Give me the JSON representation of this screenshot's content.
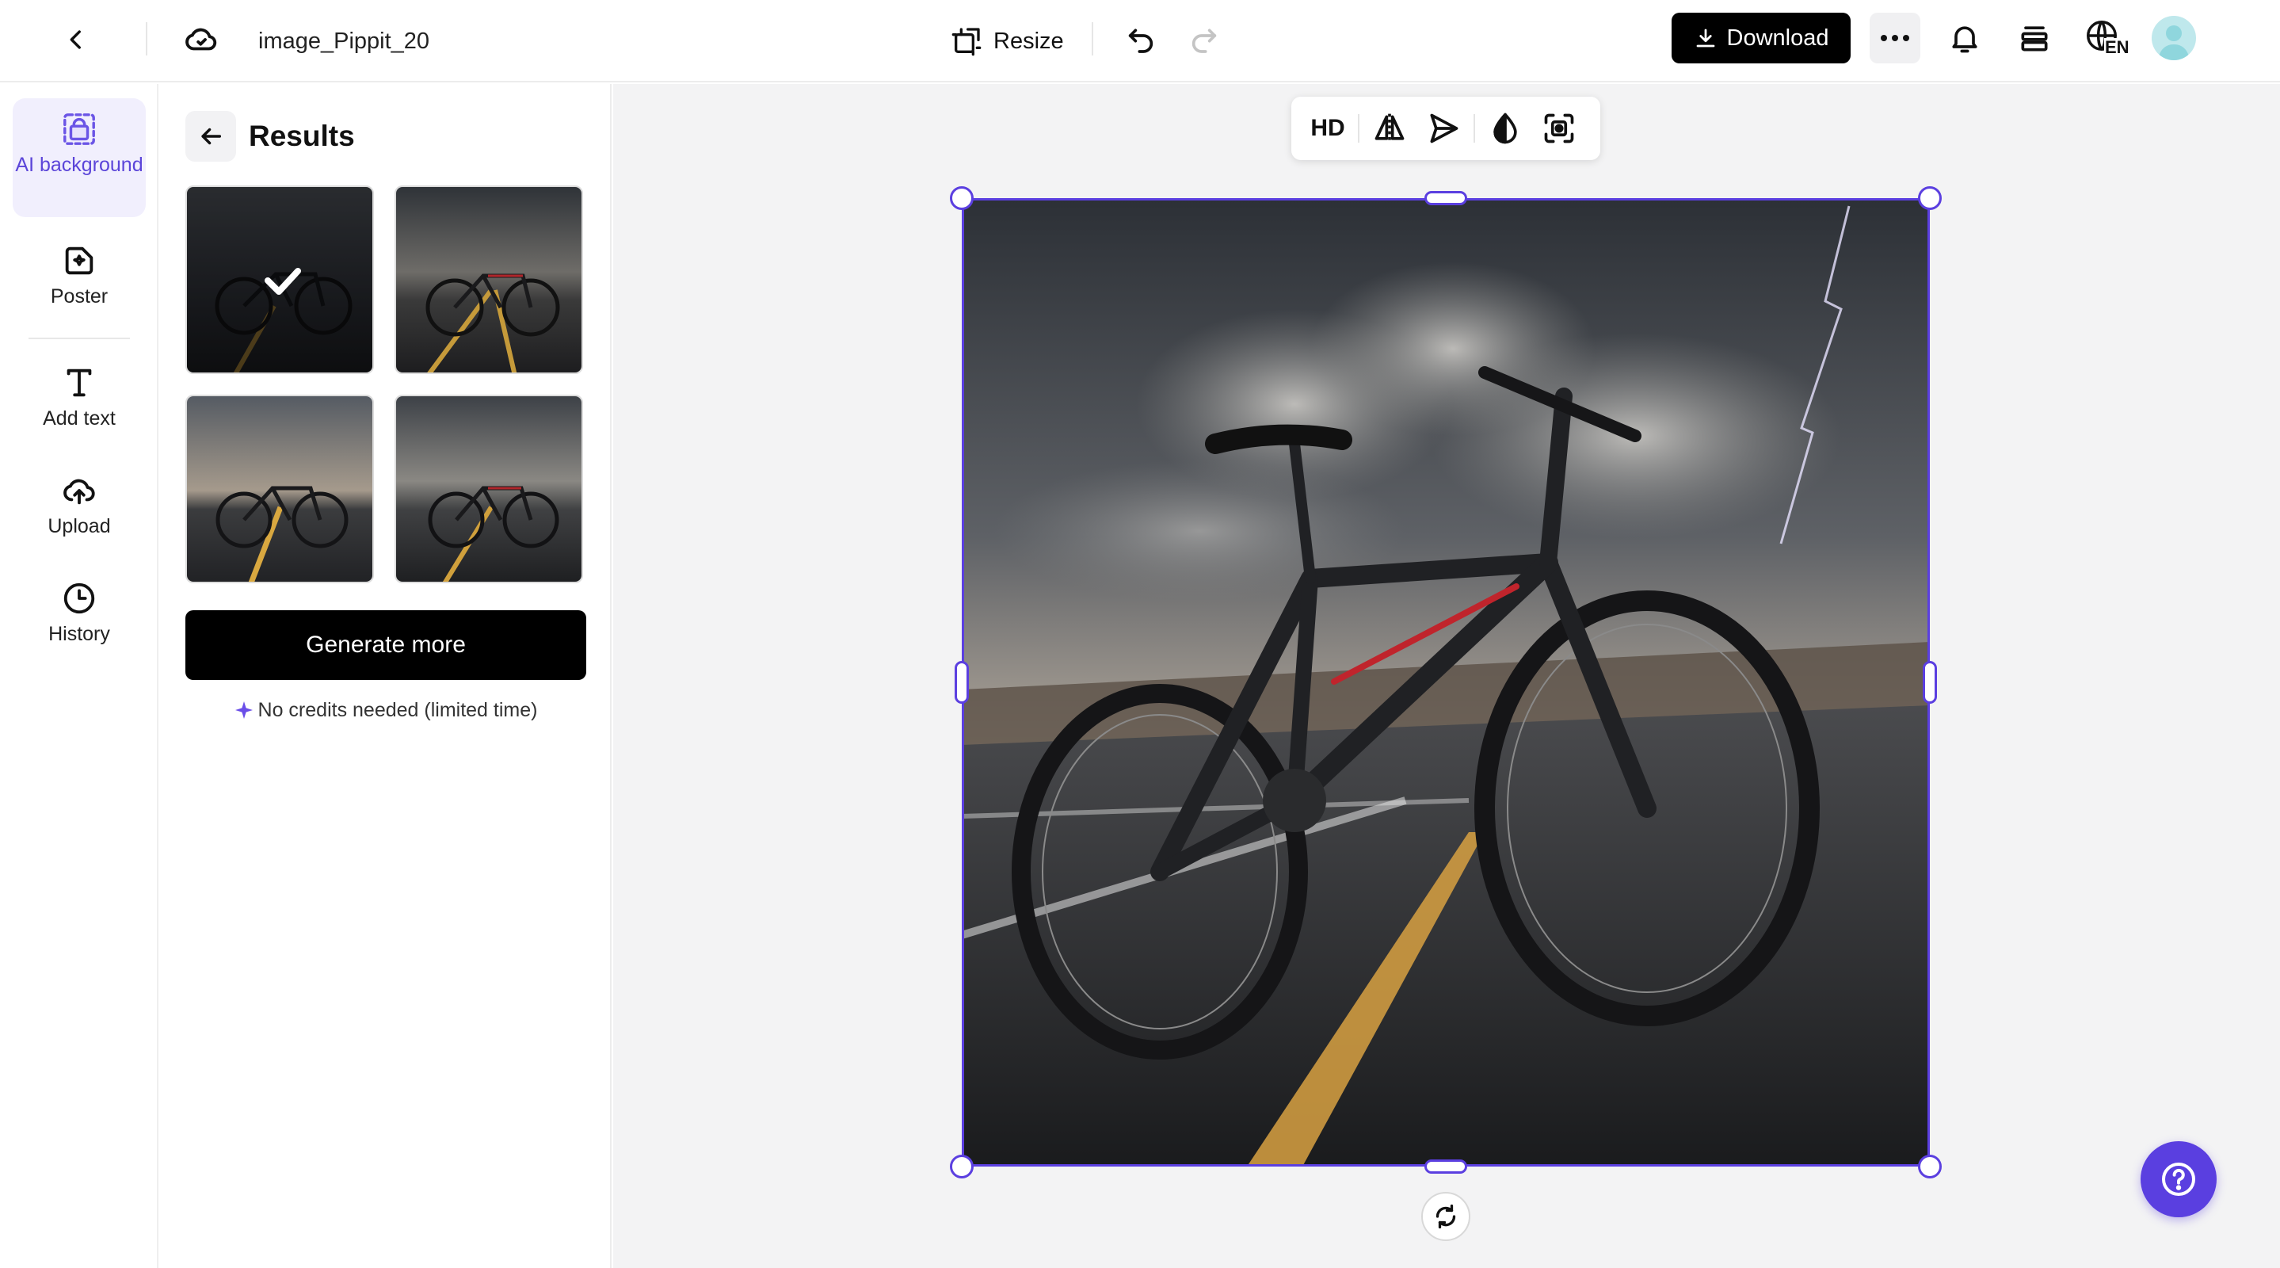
{
  "header": {
    "file_name": "image_Pippit_20",
    "resize_label": "Resize",
    "download_label": "Download",
    "language_badge": "EN",
    "icons": [
      "back-icon",
      "cloud-icon",
      "resize-icon",
      "undo-icon",
      "redo-icon",
      "download-icon",
      "more-icon",
      "bell-icon",
      "layers-icon",
      "globe-icon",
      "avatar"
    ]
  },
  "sidebar": {
    "items": [
      {
        "label": "AI background",
        "icon": "ai-background-icon",
        "active": true
      },
      {
        "label": "Poster",
        "icon": "poster-icon"
      },
      {
        "label": "Add text",
        "icon": "text-icon"
      },
      {
        "label": "Upload",
        "icon": "upload-icon"
      },
      {
        "label": "History",
        "icon": "history-icon"
      }
    ]
  },
  "results_panel": {
    "title": "Results",
    "thumbnails": [
      {
        "selected": true
      },
      {
        "selected": false
      },
      {
        "selected": false
      },
      {
        "selected": false
      }
    ],
    "generate_label": "Generate more",
    "credits_note": "No credits needed (limited time)"
  },
  "canvas": {
    "toolbar": {
      "hd_label": "HD",
      "tools": [
        "flip-icon",
        "send-icon",
        "opacity-icon",
        "remove-background-icon"
      ]
    },
    "selection_color": "#5b3fe0"
  },
  "colors": {
    "accent": "#5b3fe0",
    "primary_button": "#000000",
    "canvas_bg": "#f3f3f4"
  }
}
